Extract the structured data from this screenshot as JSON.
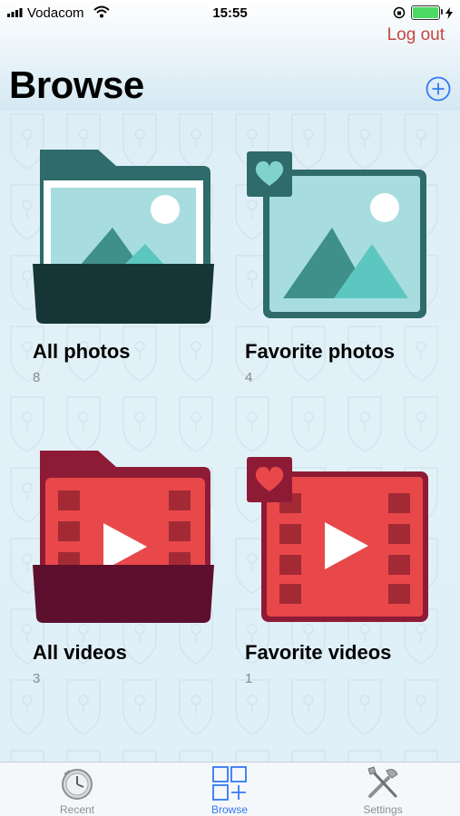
{
  "status": {
    "carrier": "Vodacom",
    "time": "15:55"
  },
  "header": {
    "logout_label": "Log out",
    "title": "Browse"
  },
  "albums": [
    {
      "label": "All photos",
      "count": "8",
      "icon": "photo-folder-icon"
    },
    {
      "label": "Favorite photos",
      "count": "4",
      "icon": "favorite-photo-icon"
    },
    {
      "label": "All videos",
      "count": "3",
      "icon": "video-folder-icon"
    },
    {
      "label": "Favorite videos",
      "count": "1",
      "icon": "favorite-video-icon"
    }
  ],
  "tabs": [
    {
      "label": "Recent",
      "icon": "clock-icon",
      "active": false
    },
    {
      "label": "Browse",
      "icon": "grid-plus-icon",
      "active": true
    },
    {
      "label": "Settings",
      "icon": "tools-icon",
      "active": false
    }
  ],
  "colors": {
    "accent": "#3478f6",
    "logout": "#c8463f",
    "photo_dark": "#2e6b6a",
    "photo_light": "#a8dde0",
    "video_red": "#e8484a",
    "video_dark": "#8e1b36"
  }
}
